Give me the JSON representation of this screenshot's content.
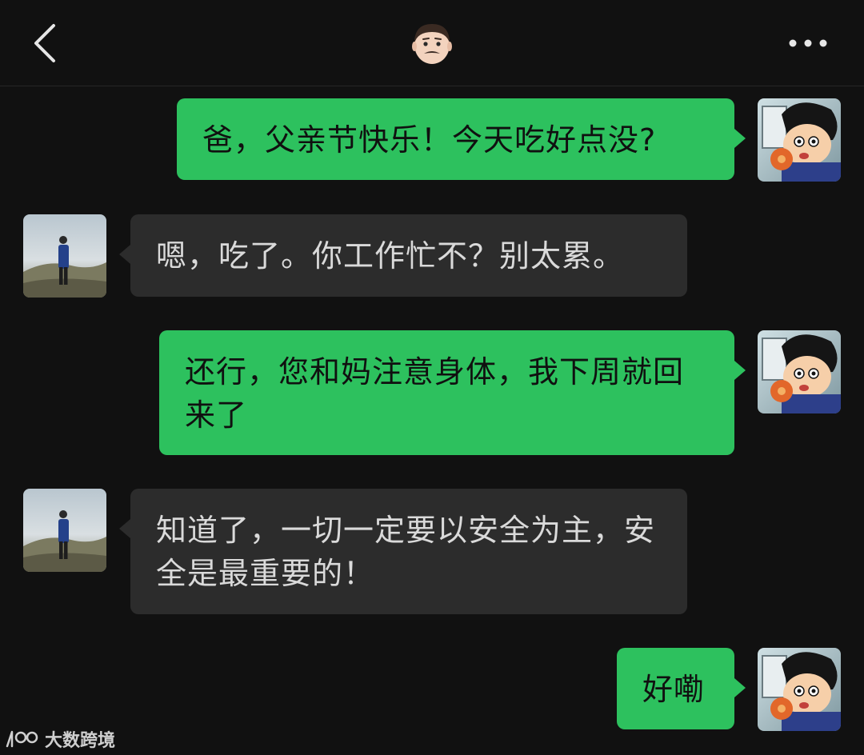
{
  "header": {
    "back_icon": "chevron-left-icon",
    "contact_emoji": "👨🏻",
    "more_icon": "more-dots-icon"
  },
  "messages": [
    {
      "side": "sent",
      "text": "爸，父亲节快乐！今天吃好点没?"
    },
    {
      "side": "recv",
      "text": "嗯，吃了。你工作忙不？别太累。"
    },
    {
      "side": "sent",
      "text": "还行，您和妈注意身体，我下周就回来了"
    },
    {
      "side": "recv",
      "text": "知道了，一切一定要以安全为主，安全是最重要的！"
    },
    {
      "side": "sent",
      "text": "好嘞"
    }
  ],
  "watermark": {
    "text": "大数跨境"
  },
  "colors": {
    "sent_bubble": "#2dc15e",
    "recv_bubble": "#2c2c2c",
    "background": "#111111"
  }
}
